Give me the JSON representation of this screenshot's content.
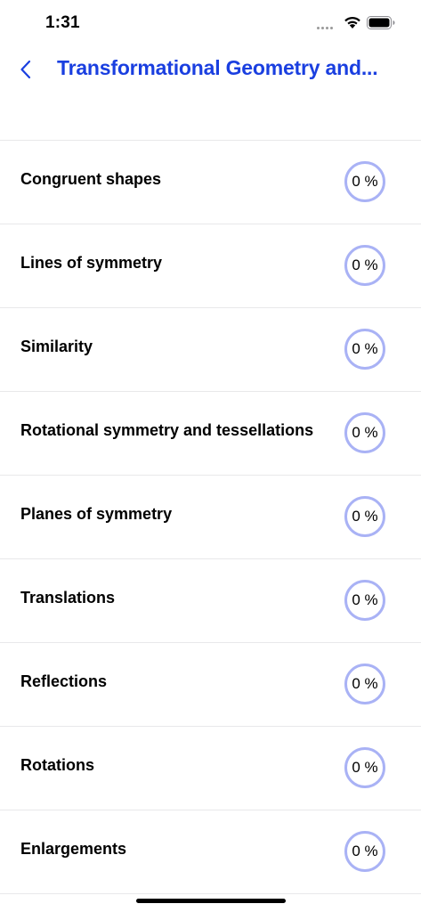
{
  "status_bar": {
    "time": "1:31",
    "signal_icon": "cellular-dots-icon",
    "wifi_icon": "wifi-icon",
    "battery_icon": "battery-icon"
  },
  "nav": {
    "back_icon": "chevron-left-icon",
    "title": "Transformational Geometry and..."
  },
  "colors": {
    "accent": "#1a3fe0",
    "ring": "#a9b2f5",
    "separator": "#e8e8ea"
  },
  "topics": [
    {
      "label": "Congruent shapes",
      "progress": "0 %"
    },
    {
      "label": "Lines of symmetry",
      "progress": "0 %"
    },
    {
      "label": "Similarity",
      "progress": "0 %"
    },
    {
      "label": "Rotational symmetry and tessellations",
      "progress": "0 %"
    },
    {
      "label": "Planes of symmetry",
      "progress": "0 %"
    },
    {
      "label": "Translations",
      "progress": "0 %"
    },
    {
      "label": "Reflections",
      "progress": "0 %"
    },
    {
      "label": "Rotations",
      "progress": "0 %"
    },
    {
      "label": "Enlargements",
      "progress": "0 %"
    }
  ]
}
